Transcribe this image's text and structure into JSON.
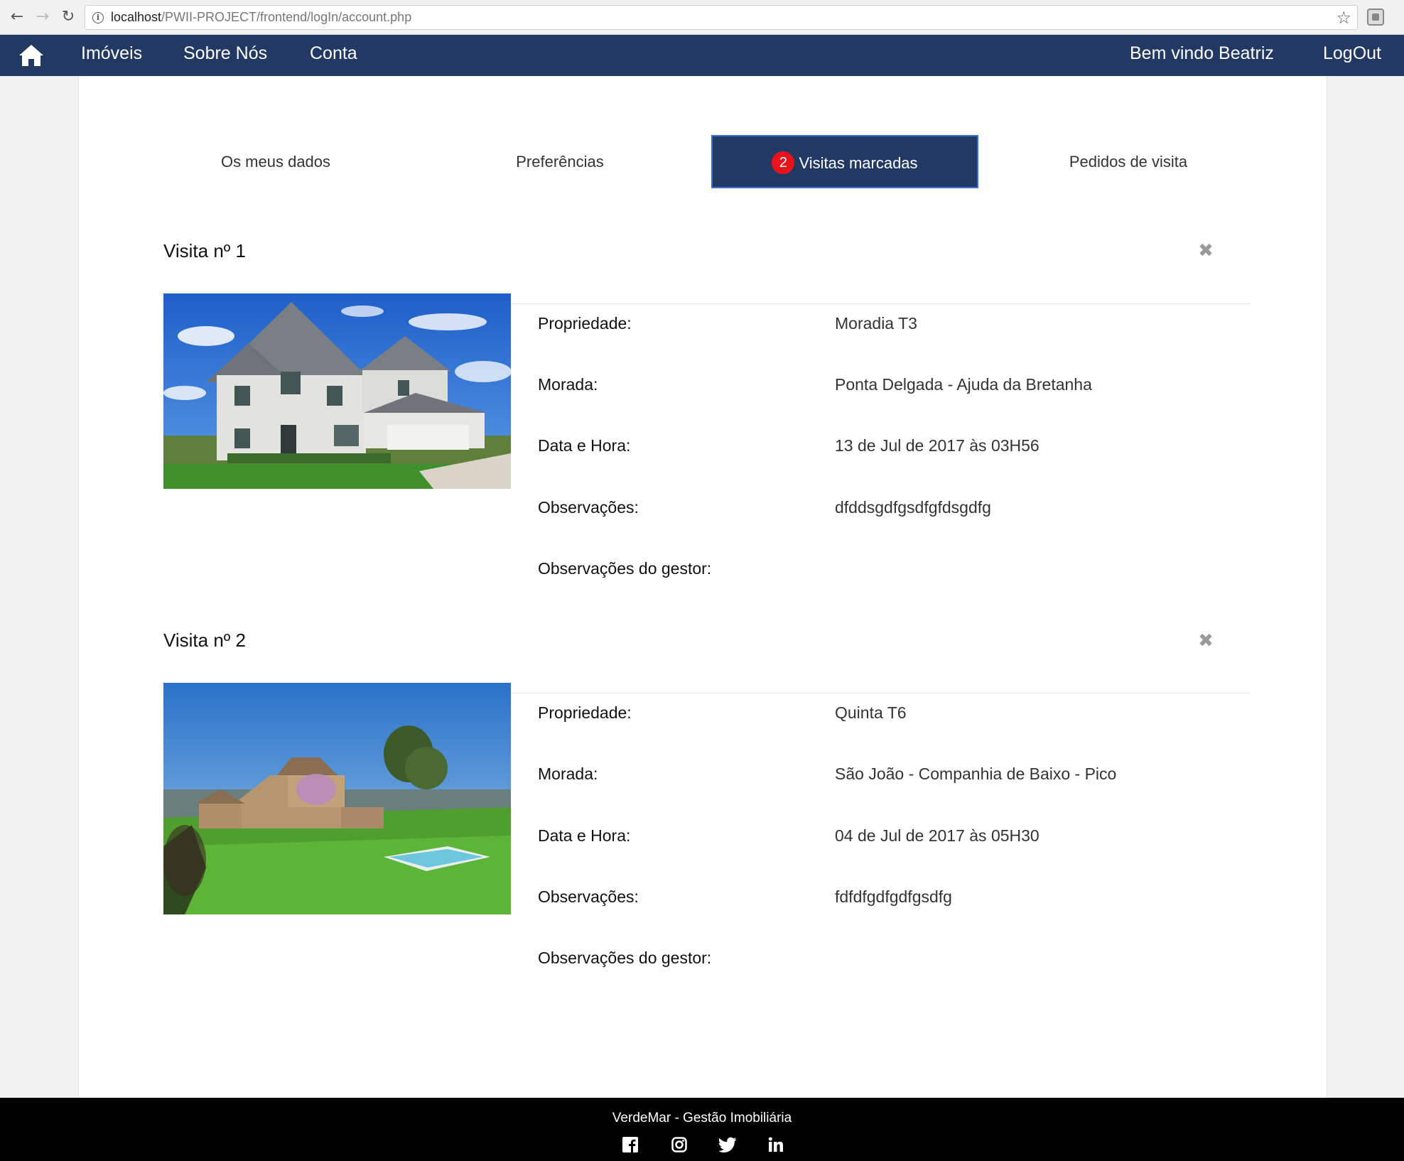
{
  "browser": {
    "url_host": "localhost",
    "url_path": "/PWII-PROJECT/frontend/logIn/account.php"
  },
  "navbar": {
    "links": [
      "Imóveis",
      "Sobre Nós",
      "Conta"
    ],
    "welcome": "Bem vindo Beatriz",
    "logout": "LogOut",
    "color": "#223a63"
  },
  "tabs": {
    "my_data": "Os meus dados",
    "preferences": "Preferências",
    "scheduled": "Visitas marcadas",
    "scheduled_badge": "2",
    "requests": "Pedidos de visita"
  },
  "labels": {
    "property": "Propriedade:",
    "address": "Morada:",
    "datetime": "Data e Hora:",
    "notes": "Observações:",
    "manager_notes": "Observações do gestor:"
  },
  "visits": [
    {
      "title": "Visita nº 1",
      "property": "Moradia T3",
      "address": "Ponta Delgada - Ajuda da Bretanha",
      "datetime": "13 de Jul de 2017 às 03H56",
      "notes": "dfddsgdfgsdfgfdsgdfg",
      "manager_notes": ""
    },
    {
      "title": "Visita nº 2",
      "property": "Quinta T6",
      "address": "São João - Companhia de Baixo - Pico",
      "datetime": "04 de Jul de 2017 às 05H30",
      "notes": "fdfdfgdfgdfgsdfg",
      "manager_notes": ""
    }
  ],
  "footer": {
    "text": "VerdeMar - Gestão Imobiliária",
    "social": [
      "facebook-icon",
      "instagram-icon",
      "twitter-icon",
      "linkedin-icon"
    ]
  }
}
